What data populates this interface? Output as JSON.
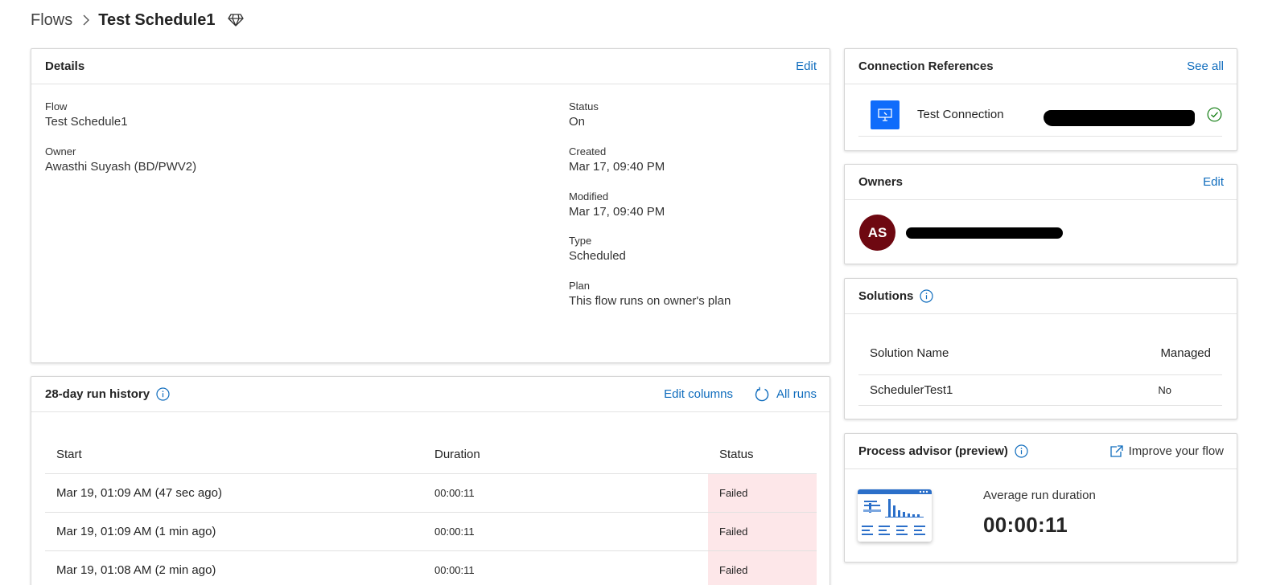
{
  "breadcrumb": {
    "root": "Flows",
    "current": "Test Schedule1",
    "premium_icon": "diamond-icon"
  },
  "details": {
    "title": "Details",
    "edit_label": "Edit",
    "flow_label": "Flow",
    "flow_value": "Test Schedule1",
    "owner_label": "Owner",
    "owner_value": "Awasthi Suyash (BD/PWV2)",
    "status_label": "Status",
    "status_value": "On",
    "created_label": "Created",
    "created_value": "Mar 17, 09:40 PM",
    "modified_label": "Modified",
    "modified_value": "Mar 17, 09:40 PM",
    "type_label": "Type",
    "type_value": "Scheduled",
    "plan_label": "Plan",
    "plan_value": "This flow runs on owner's plan"
  },
  "run_history": {
    "title": "28-day run history",
    "edit_columns_label": "Edit columns",
    "all_runs_label": "All runs",
    "columns": [
      "Start",
      "Duration",
      "Status"
    ],
    "rows": [
      {
        "start": "Mar 19, 01:09 AM (47 sec ago)",
        "duration": "00:00:11",
        "status": "Failed"
      },
      {
        "start": "Mar 19, 01:09 AM (1 min ago)",
        "duration": "00:00:11",
        "status": "Failed"
      },
      {
        "start": "Mar 19, 01:08 AM (2 min ago)",
        "duration": "00:00:11",
        "status": "Failed"
      }
    ],
    "failed_color": "#fde7e9"
  },
  "connection_references": {
    "title": "Connection References",
    "see_all_label": "See all",
    "items": [
      {
        "name": "Test Connection",
        "icon": "monitor-icon",
        "status_icon": "check-circle-icon"
      }
    ]
  },
  "owners": {
    "title": "Owners",
    "edit_label": "Edit",
    "items": [
      {
        "initials": "AS",
        "avatar_color": "#6e0811"
      }
    ]
  },
  "solutions": {
    "title": "Solutions",
    "col_name": "Solution Name",
    "col_managed": "Managed",
    "rows": [
      {
        "name": "SchedulerTest1",
        "managed": "No"
      }
    ]
  },
  "process_advisor": {
    "title": "Process advisor (preview)",
    "improve_label": "Improve your flow",
    "metric_label": "Average run duration",
    "metric_value": "00:00:11"
  },
  "colors": {
    "link": "#0f6cbd",
    "connector_blue": "#0f6cfb",
    "success": "#107c10"
  }
}
